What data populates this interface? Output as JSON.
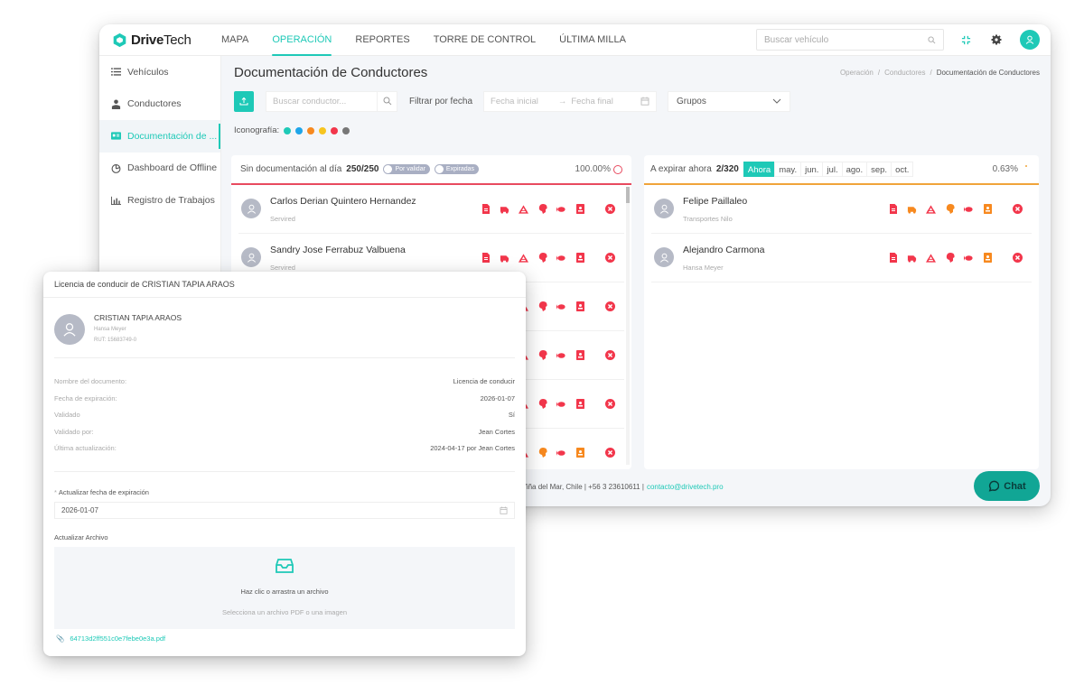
{
  "brand": {
    "bold": "Drive",
    "light": "Tech",
    "color": "#1ec9b7"
  },
  "nav": {
    "items": [
      {
        "label": "MAPA",
        "active": false
      },
      {
        "label": "OPERACIÓN",
        "active": true
      },
      {
        "label": "REPORTES",
        "active": false
      },
      {
        "label": "TORRE DE CONTROL",
        "active": false
      },
      {
        "label": "ÚLTIMA MILLA",
        "active": false
      }
    ],
    "search_placeholder": "Buscar vehículo",
    "icons": [
      "search-icon",
      "fullscreen-icon",
      "gear-icon",
      "user-avatar-icon"
    ]
  },
  "sidebar": {
    "items": [
      {
        "label": "Vehículos",
        "icon": "list-icon",
        "active": false
      },
      {
        "label": "Conductores",
        "icon": "driver-icon",
        "active": false
      },
      {
        "label": "Documentación de ...",
        "icon": "id-card-icon",
        "active": true
      },
      {
        "label": "Dashboard de Offline",
        "icon": "pie-chart-icon",
        "active": false
      },
      {
        "label": "Registro de Trabajos",
        "icon": "bar-chart-icon",
        "active": false
      }
    ]
  },
  "page": {
    "title": "Documentación de Conductores",
    "breadcrumb": [
      "Operación",
      "Conductores",
      "Documentación de Conductores"
    ]
  },
  "toolbar": {
    "search_placeholder": "Buscar conductor...",
    "filter_label": "Filtrar por fecha",
    "date_start_placeholder": "Fecha inicial",
    "date_end_placeholder": "Fecha final",
    "groups_label": "Grupos"
  },
  "iconography": {
    "label": "Iconografía:",
    "colors": [
      "#1ec9b7",
      "#1ea5e9",
      "#f7891f",
      "#f7c51f",
      "#f2364b",
      "#777777"
    ]
  },
  "left_panel": {
    "title": "Sin documentación al día",
    "count": "250/250",
    "toggles": [
      "Por validar",
      "Expiradas"
    ],
    "percent": "100.00%",
    "rows": [
      {
        "name": "Carlos Derian Quintero Hernandez",
        "company": "Servired",
        "icon_colors": [
          "#f2364b",
          "#f2364b",
          "#f2364b",
          "#f2364b",
          "#f2364b",
          "#f2364b"
        ]
      },
      {
        "name": "Sandry Jose Ferrabuz Valbuena",
        "company": "Servired",
        "icon_colors": [
          "#f2364b",
          "#f2364b",
          "#f2364b",
          "#f2364b",
          "#f2364b",
          "#f2364b"
        ]
      },
      {
        "name": "",
        "company": "",
        "icon_colors": [
          "#f2364b",
          "#f2364b",
          "#f2364b",
          "#f2364b",
          "#f2364b",
          "#f2364b"
        ]
      },
      {
        "name": "",
        "company": "",
        "icon_colors": [
          "#f2364b",
          "#f2364b",
          "#f2364b",
          "#f2364b",
          "#f2364b",
          "#f2364b"
        ]
      },
      {
        "name": "",
        "company": "",
        "icon_colors": [
          "#f2364b",
          "#f2364b",
          "#f2364b",
          "#f2364b",
          "#f2364b",
          "#f2364b"
        ]
      },
      {
        "name": "",
        "company": "",
        "icon_colors": [
          "#f2364b",
          "#f2364b",
          "#f2364b",
          "#f7891f",
          "#f2364b",
          "#f7891f"
        ]
      }
    ]
  },
  "right_panel": {
    "title": "A expirar ahora",
    "count": "2/320",
    "months": [
      {
        "label": "Ahora",
        "active": true
      },
      {
        "label": "may.",
        "active": false
      },
      {
        "label": "jun.",
        "active": false
      },
      {
        "label": "jul.",
        "active": false
      },
      {
        "label": "ago.",
        "active": false
      },
      {
        "label": "sep.",
        "active": false
      },
      {
        "label": "oct.",
        "active": false
      }
    ],
    "percent": "0.63%",
    "rows": [
      {
        "name": "Felipe Paillaleo",
        "company": "Transportes Nilo",
        "icon_colors": [
          "#f2364b",
          "#f7891f",
          "#f2364b",
          "#f7891f",
          "#f2364b",
          "#f7891f"
        ]
      },
      {
        "name": "Alejandro Carmona",
        "company": "Hansa Meyer",
        "icon_colors": [
          "#f2364b",
          "#f2364b",
          "#f2364b",
          "#f2364b",
          "#f2364b",
          "#f7891f"
        ]
      }
    ]
  },
  "doc_icons": [
    "document-icon",
    "truck-icon",
    "road-icon",
    "head-icon",
    "fish-icon",
    "badge-icon"
  ],
  "footer": {
    "address": "almaceda 183, Oficina 301, Reñaca, Viña del Mar, Chile | +56 3 23610611 |",
    "email": "contacto@drivetech.pro",
    "chat_label": "Chat"
  },
  "modal": {
    "title": "Licencia de conducir de CRISTIAN TAPIA ARAOS",
    "driver": {
      "name": "CRISTIAN TAPIA ARAOS",
      "company": "Hansa Meyer",
      "rut": "RUT: 15683749-0"
    },
    "details": [
      {
        "key": "Nombre del documento:",
        "value": "Licencia de conducir"
      },
      {
        "key": "Fecha de expiración:",
        "value": "2026-01-07"
      },
      {
        "key": "Validado",
        "value": "Sí"
      },
      {
        "key": "Validado por:",
        "value": "Jean Cortes"
      },
      {
        "key": "Última actualización:",
        "value": "2024-04-17 por Jean Cortes"
      }
    ],
    "expiration_label": "Actualizar fecha de expiración",
    "expiration_value": "2026-01-07",
    "file_label": "Actualizar Archivo",
    "dropzone_main": "Haz clic o arrastra un archivo",
    "dropzone_hint": "Selecciona un archivo PDF o una imagen",
    "file_name": "64713d2ff551c0e7febe0e3a.pdf"
  }
}
